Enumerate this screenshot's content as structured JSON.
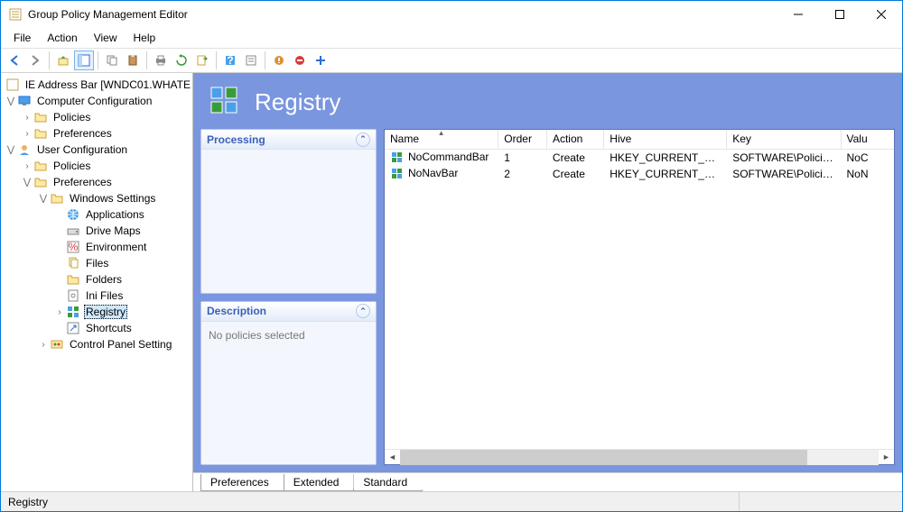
{
  "window": {
    "title": "Group Policy Management Editor"
  },
  "menubar": [
    "File",
    "Action",
    "View",
    "Help"
  ],
  "tree": {
    "root": "IE Address Bar [WNDC01.WHATE",
    "computer_config": "Computer Configuration",
    "cc_policies": "Policies",
    "cc_prefs": "Preferences",
    "user_config": "User Configuration",
    "uc_policies": "Policies",
    "uc_prefs": "Preferences",
    "win_settings": "Windows Settings",
    "apps": "Applications",
    "drivemaps": "Drive Maps",
    "env": "Environment",
    "files": "Files",
    "folders": "Folders",
    "inifiles": "Ini Files",
    "registry": "Registry",
    "shortcuts": "Shortcuts",
    "cpanel": "Control Panel Setting"
  },
  "header": {
    "title": "Registry"
  },
  "cards": {
    "processing": "Processing",
    "description": "Description",
    "desc_body": "No policies selected"
  },
  "columns": {
    "name": "Name",
    "order": "Order",
    "action": "Action",
    "hive": "Hive",
    "key": "Key",
    "value": "Valu"
  },
  "rows": [
    {
      "name": "NoCommandBar",
      "order": "1",
      "action": "Create",
      "hive": "HKEY_CURRENT_USER",
      "key": "SOFTWARE\\Policies\\Micr...",
      "value": "NoC"
    },
    {
      "name": "NoNavBar",
      "order": "2",
      "action": "Create",
      "hive": "HKEY_CURRENT_USER",
      "key": "SOFTWARE\\Policies\\Micr...",
      "value": "NoN"
    }
  ],
  "tabs": [
    "Preferences",
    "Extended",
    "Standard"
  ],
  "status": "Registry"
}
